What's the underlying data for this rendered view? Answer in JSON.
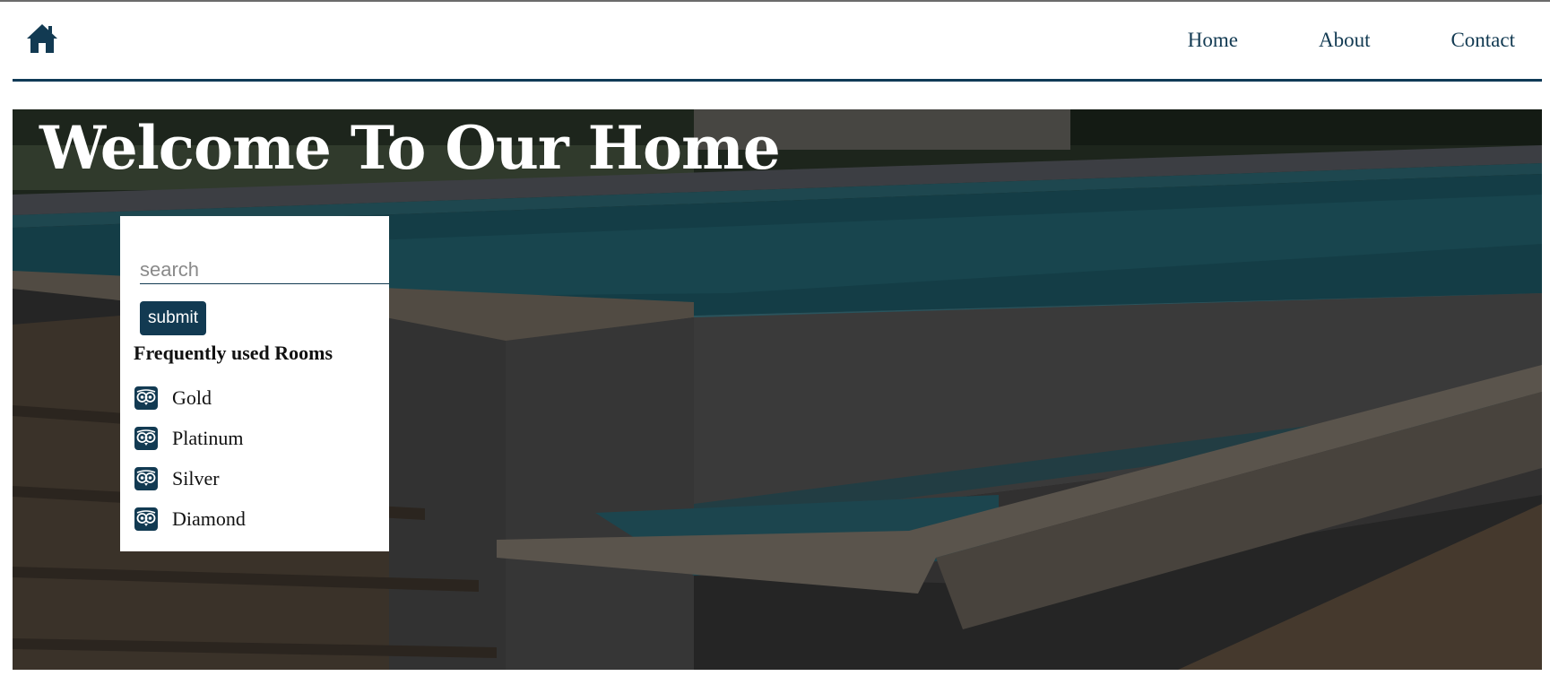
{
  "header": {
    "home_icon": "home-icon",
    "nav": [
      {
        "label": "Home"
      },
      {
        "label": "About"
      },
      {
        "label": "Contact"
      }
    ]
  },
  "hero": {
    "title": "Welcome To Our Home",
    "background": "pool-photo"
  },
  "search": {
    "placeholder": "search",
    "value": "",
    "submit_label": "submit"
  },
  "rooms": {
    "heading": "Frequently used Rooms",
    "icon": "owl-icon",
    "items": [
      {
        "label": "Gold"
      },
      {
        "label": "Platinum"
      },
      {
        "label": "Silver"
      },
      {
        "label": "Diamond"
      }
    ]
  },
  "colors": {
    "brand": "#123a52",
    "overlay": "#000000"
  }
}
